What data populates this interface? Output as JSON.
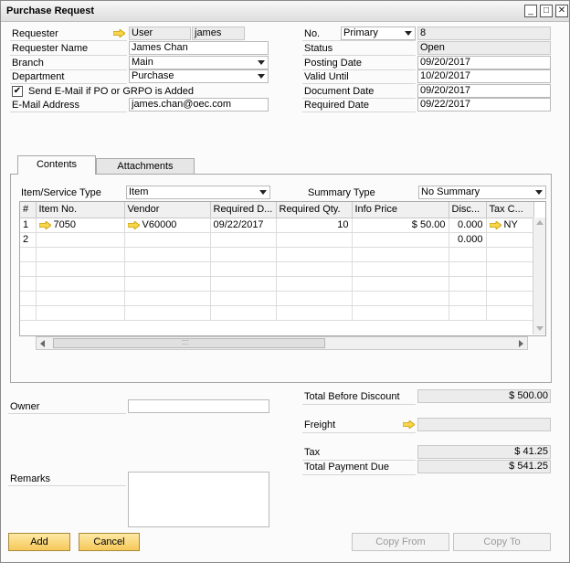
{
  "window": {
    "title": "Purchase Request"
  },
  "header_left": {
    "requester_label": "Requester",
    "requester_type": "User",
    "requester_code": "james",
    "requester_name_label": "Requester Name",
    "requester_name": "James Chan",
    "branch_label": "Branch",
    "branch_value": "Main",
    "department_label": "Department",
    "department_value": "Purchase",
    "send_email_label": "Send E-Mail if PO or GRPO is Added",
    "send_email_checked": true,
    "email_label": "E-Mail Address",
    "email_value": "james.chan@oec.com"
  },
  "header_right": {
    "no_label": "No.",
    "series_value": "Primary",
    "no_value": "8",
    "status_label": "Status",
    "status_value": "Open",
    "posting_date_label": "Posting Date",
    "posting_date": "09/20/2017",
    "valid_until_label": "Valid Until",
    "valid_until": "10/20/2017",
    "document_date_label": "Document Date",
    "document_date": "09/20/2017",
    "required_date_label": "Required Date",
    "required_date": "09/22/2017"
  },
  "tabs": [
    {
      "label": "Contents"
    },
    {
      "label": "Attachments"
    }
  ],
  "contents": {
    "item_type_label": "Item/Service Type",
    "item_type_value": "Item",
    "summary_type_label": "Summary Type",
    "summary_type_value": "No Summary",
    "columns": [
      "#",
      "Item No.",
      "Vendor",
      "Required D...",
      "Required Qty.",
      "Info Price",
      "Disc...",
      "Tax C..."
    ],
    "rows": [
      {
        "num": "1",
        "item_no": "7050",
        "vendor": "V60000",
        "required_date": "09/22/2017",
        "qty": "10",
        "price": "$ 50.00",
        "disc": "0.000",
        "tax": "NY"
      },
      {
        "num": "2",
        "item_no": "",
        "vendor": "",
        "required_date": "",
        "qty": "",
        "price": "",
        "disc": "0.000",
        "tax": ""
      }
    ],
    "scroll_grip": ":::"
  },
  "footer": {
    "owner_label": "Owner",
    "remarks_label": "Remarks",
    "total_before_discount_label": "Total Before Discount",
    "total_before_discount": "$ 500.00",
    "freight_label": "Freight",
    "tax_label": "Tax",
    "tax_value": "$ 41.25",
    "total_payment_label": "Total Payment Due",
    "total_payment": "$ 541.25"
  },
  "buttons": {
    "add": "Add",
    "cancel": "Cancel",
    "copy_from": "Copy From",
    "copy_to": "Copy To"
  },
  "colors": {
    "arrow_fill": "#f7d64a",
    "arrow_stroke": "#c79a00",
    "primary_button": "#f6c85a"
  }
}
